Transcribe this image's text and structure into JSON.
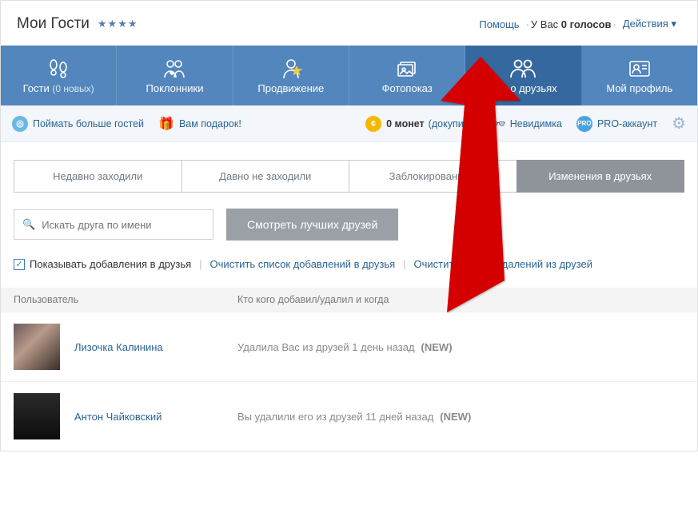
{
  "header": {
    "title": "Мои Гости",
    "stars": "★★★★",
    "help_label": "Помощь",
    "votes_prefix": "У Вас ",
    "votes_count": "0 голосов",
    "actions_label": "Действия"
  },
  "nav": {
    "tabs": [
      {
        "icon": "footprints-icon",
        "label": "Гости",
        "extra": "(0 новых)"
      },
      {
        "icon": "heart-people-icon",
        "label": "Поклонники",
        "extra": ""
      },
      {
        "icon": "promote-star-icon",
        "label": "Продвижение",
        "extra": ""
      },
      {
        "icon": "photo-stack-icon",
        "label": "Фотопоказ",
        "extra": ""
      },
      {
        "icon": "friends-group-icon",
        "label": "Всё о друзьях",
        "extra": ""
      },
      {
        "icon": "profile-card-icon",
        "label": "Мой профиль",
        "extra": ""
      }
    ],
    "active_index": 4
  },
  "subbar": {
    "catch_guests": "Поймать больше гостей",
    "gift": "Вам подарок!",
    "coins_count": "0 монет",
    "buy_more": "(докупить)",
    "invisible": "Невидимка",
    "pro": "PRO-аккаунт"
  },
  "filter_tabs": {
    "items": [
      "Недавно заходили",
      "Давно не заходили",
      "Заблокированные",
      "Изменения в друзьях"
    ],
    "active_index": 3
  },
  "search": {
    "placeholder": "Искать друга по имени",
    "best_friends_btn": "Смотреть лучших друзей"
  },
  "options": {
    "show_adds": "Показывать добавления в друзья",
    "clear_adds": "Очистить список добавлений в друзья",
    "clear_dels": "Очистить список удалений из друзей"
  },
  "table": {
    "head_user": "Пользователь",
    "head_who": "Кто кого добавил/удалил и когда"
  },
  "rows": [
    {
      "avatar_bg": "linear-gradient(135deg,#6b5a58 0%,#b79a8a 40%,#3a2d29 100%)",
      "name": "Лизочка Калинина",
      "status": "Удалила Вас из друзей 1 день назад",
      "new": "(NEW)"
    },
    {
      "avatar_bg": "linear-gradient(180deg,#2a2a2a 0%,#0d0d0d 100%)",
      "name": "Антон Чайковский",
      "status": "Вы удалили его из друзей 11 дней назад",
      "new": "(NEW)"
    }
  ]
}
